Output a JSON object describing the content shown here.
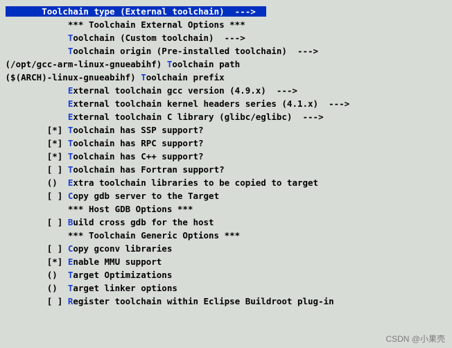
{
  "menu": {
    "rows": [
      {
        "prefix": "    ",
        "hot": "T",
        "text": "oolchain type (External toolchain)  --->",
        "selected": true,
        "bold": true
      },
      {
        "prefix": "    ",
        "hot": "",
        "text": "*** Toolchain External Options ***",
        "bold": true
      },
      {
        "prefix": "    ",
        "hot": "T",
        "text": "oolchain (Custom toolchain)  --->",
        "bold": true
      },
      {
        "prefix": "    ",
        "hot": "T",
        "text": "oolchain origin (Pre-installed toolchain)  --->",
        "bold": true
      },
      {
        "prefix_override": "(/opt/gcc-arm-linux-gnueabihf) ",
        "hot": "T",
        "text": "oolchain path",
        "bold": true
      },
      {
        "prefix_override": "($(ARCH)-linux-gnueabihf) ",
        "hot": "T",
        "text": "oolchain prefix",
        "bold": true
      },
      {
        "prefix": "    ",
        "hot": "E",
        "text": "xternal toolchain gcc version (4.9.x)  --->",
        "bold": true
      },
      {
        "prefix": "    ",
        "hot": "E",
        "text": "xternal toolchain kernel headers series (4.1.x)  --->",
        "bold": true
      },
      {
        "prefix": "    ",
        "hot": "E",
        "text": "xternal toolchain C library (glibc/eglibc)  --->",
        "bold": true
      },
      {
        "prefix": "[*] ",
        "hot": "T",
        "text": "oolchain has SSP support?",
        "bold": true
      },
      {
        "prefix": "[*] ",
        "hot": "T",
        "text": "oolchain has RPC support?",
        "bold": true
      },
      {
        "prefix": "[*] ",
        "hot": "T",
        "text": "oolchain has C++ support?",
        "bold": true
      },
      {
        "prefix": "[ ] ",
        "hot": "T",
        "text": "oolchain has Fortran support?",
        "bold": true
      },
      {
        "prefix": "()  ",
        "hot": "E",
        "text": "xtra toolchain libraries to be copied to target",
        "bold": true
      },
      {
        "prefix": "[ ] ",
        "hot": "C",
        "text": "opy gdb server to the Target",
        "bold": true
      },
      {
        "prefix": "    ",
        "hot": "",
        "text": "*** Host GDB Options ***",
        "bold": true
      },
      {
        "prefix": "[ ] ",
        "hot": "B",
        "text": "uild cross gdb for the host",
        "bold": true
      },
      {
        "prefix": "    ",
        "hot": "",
        "text": "*** Toolchain Generic Options ***",
        "bold": true
      },
      {
        "prefix": "[ ] ",
        "hot": "C",
        "text": "opy gconv libraries",
        "bold": true
      },
      {
        "prefix": "[*] ",
        "hot": "E",
        "text": "nable MMU support",
        "bold": true
      },
      {
        "prefix": "()  ",
        "hot": "T",
        "text": "arget Optimizations",
        "bold": true
      },
      {
        "prefix": "()  ",
        "hot": "T",
        "text": "arget linker options",
        "bold": true
      },
      {
        "prefix": "[ ] ",
        "hot": "R",
        "text": "egister toolchain within Eclipse Buildroot plug-in",
        "bold": true
      }
    ],
    "left_margin_normal": "         ",
    "left_margin_selected_gap": " ",
    "selected_indent": "   ",
    "left_override_indent": " "
  },
  "watermark": "CSDN @小果壳"
}
